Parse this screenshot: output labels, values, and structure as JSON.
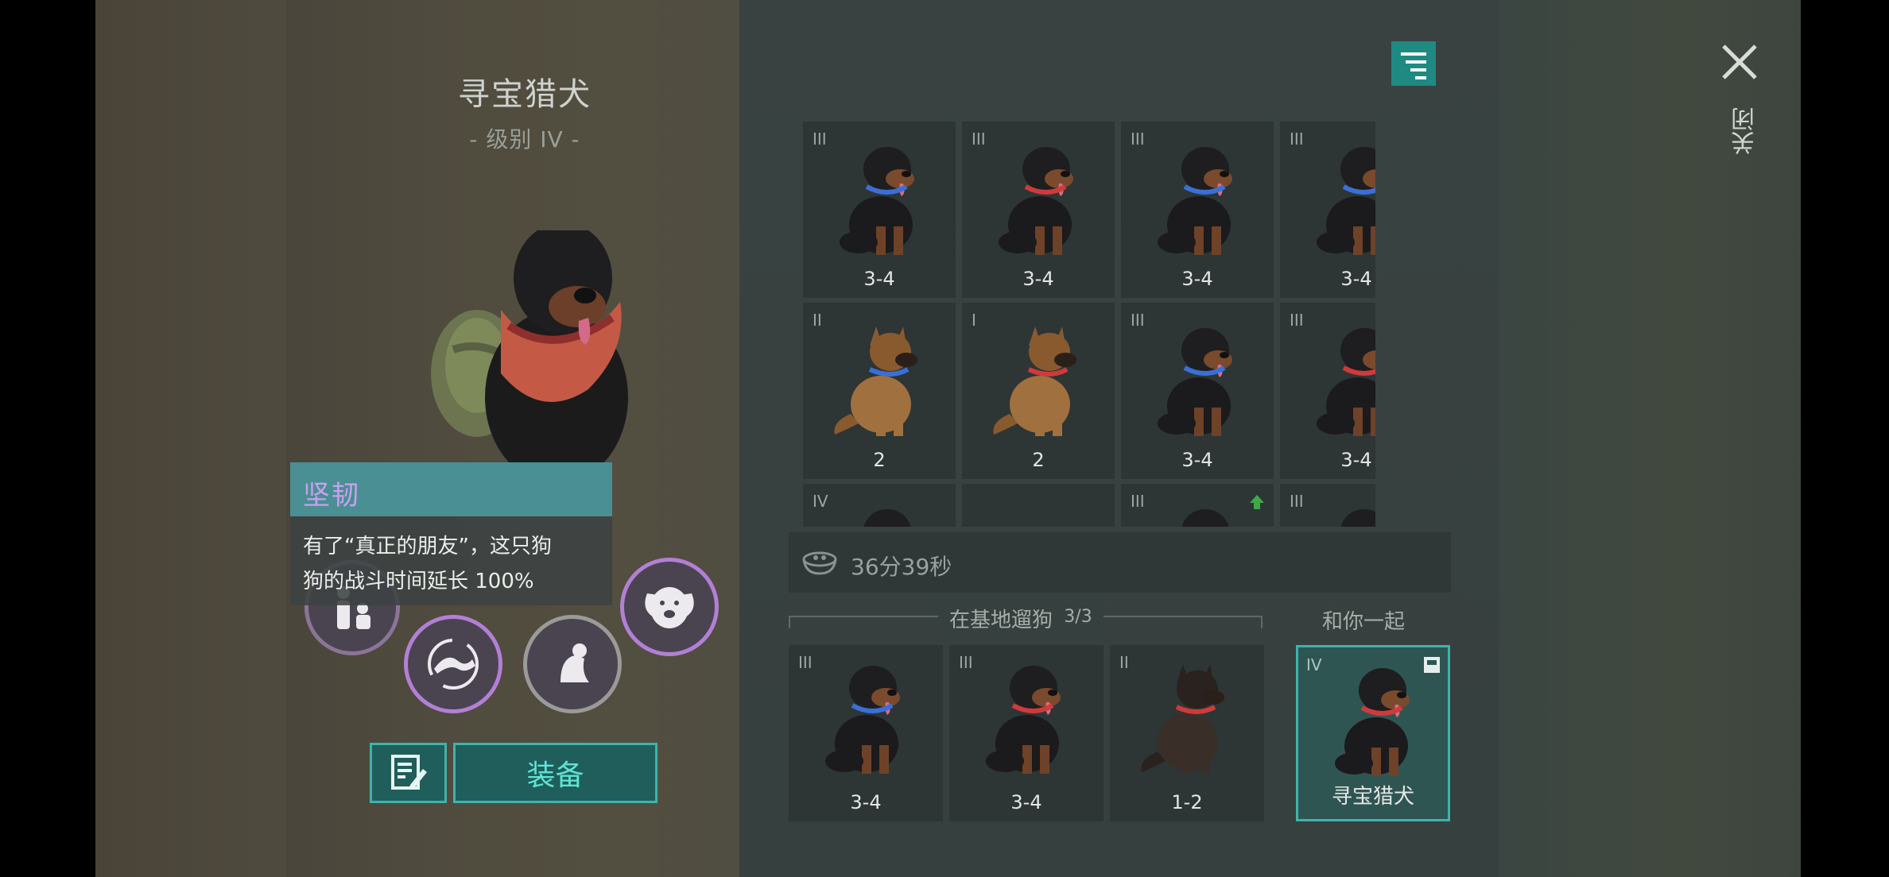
{
  "dog": {
    "name": "寻宝猎犬",
    "level": "- 级别 IV -"
  },
  "tooltip": {
    "title": "坚韧",
    "line1": "有了“真正的朋友”，这只狗",
    "line2": "狗的战斗时间延长 100%"
  },
  "buttons": {
    "equip": "装备",
    "close": "关闭"
  },
  "grid": [
    {
      "tier": "III",
      "label": "3-4",
      "breed": "rottweiler",
      "collar": "#3a6fd8"
    },
    {
      "tier": "III",
      "label": "3-4",
      "breed": "rottweiler",
      "collar": "#d03a3a"
    },
    {
      "tier": "III",
      "label": "3-4",
      "breed": "rottweiler",
      "collar": "#3a6fd8"
    },
    {
      "tier": "III",
      "label": "3-4",
      "breed": "rottweiler",
      "collar": "#3a6fd8"
    },
    {
      "tier": "II",
      "label": "2",
      "breed": "shepherd",
      "collar": "#3a6fd8"
    },
    {
      "tier": "I",
      "label": "2",
      "breed": "shepherd",
      "collar": "#d03a3a"
    },
    {
      "tier": "III",
      "label": "3-4",
      "breed": "rottweiler",
      "collar": "#3a6fd8"
    },
    {
      "tier": "III",
      "label": "3-4",
      "breed": "rottweiler",
      "collar": "#d03a3a"
    },
    {
      "tier": "IV",
      "label": "",
      "breed": "rottweiler",
      "collar": "#d03a3a"
    },
    {
      "tier": "",
      "label": "",
      "breed": "",
      "collar": ""
    },
    {
      "tier": "III",
      "label": "",
      "breed": "rottweiler",
      "collar": "#3a6fd8",
      "upgrade": true
    },
    {
      "tier": "III",
      "label": "",
      "breed": "rottweiler",
      "collar": "#3a6fd8",
      "upgrade": true
    }
  ],
  "timer": {
    "icon": "food-bowl-icon",
    "text": "36分39秒"
  },
  "base": {
    "header": "在基地遛狗",
    "count": "3/3",
    "dogs": [
      {
        "tier": "III",
        "label": "3-4",
        "breed": "rottweiler",
        "collar": "#3a6fd8"
      },
      {
        "tier": "III",
        "label": "3-4",
        "breed": "rottweiler",
        "collar": "#d03a3a"
      },
      {
        "tier": "II",
        "label": "1-2",
        "breed": "shepherd-dark",
        "collar": "#d03a3a"
      }
    ]
  },
  "with_you": {
    "header": "和你一起",
    "dog": {
      "tier": "IV",
      "label": "寻宝猎犬",
      "breed": "rottweiler",
      "collar": "#d03a3a"
    }
  },
  "colors": {
    "accent": "#3fb3aa",
    "skill_ring": "#b37fd6",
    "upgrade": "#3fa84a"
  }
}
